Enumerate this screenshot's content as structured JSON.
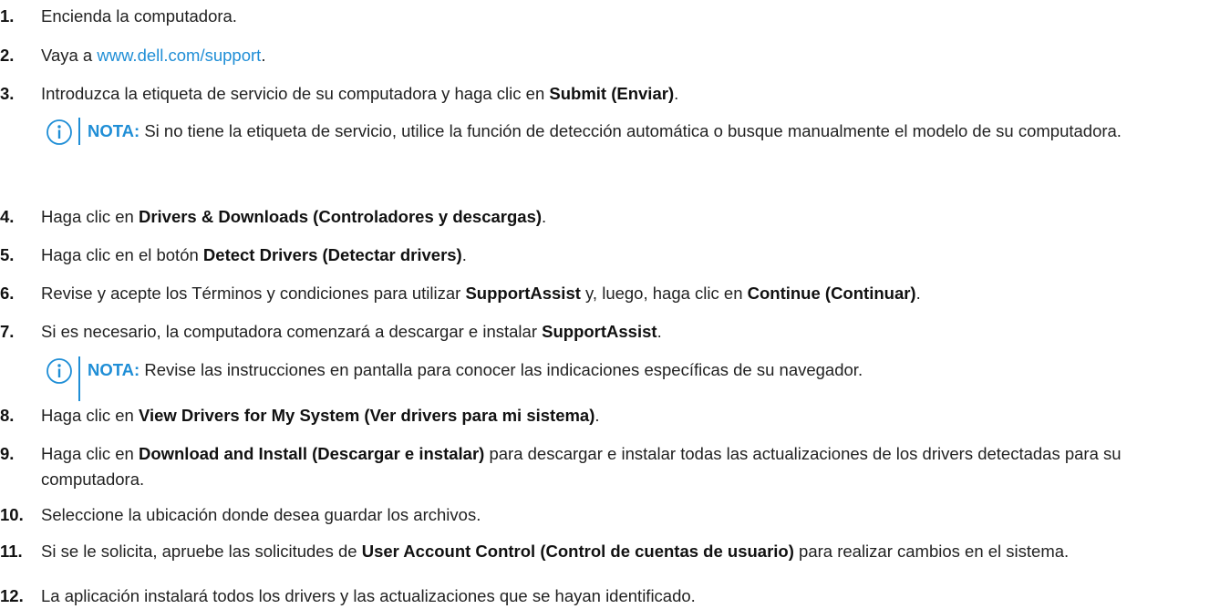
{
  "steps": [
    {
      "num": "1.",
      "text": "Encienda la computadora."
    },
    {
      "num": "2.",
      "prefix": "Vaya a ",
      "link": "www.dell.com/support",
      "suffix": "."
    },
    {
      "num": "3.",
      "prefix": "Introduzca la etiqueta de servicio de su computadora y haga clic en ",
      "bold": "Submit (Enviar)",
      "suffix": "."
    },
    {
      "num": "4.",
      "prefix": "Haga clic en ",
      "bold": "Drivers & Downloads (Controladores y descargas)",
      "suffix": "."
    },
    {
      "num": "5.",
      "prefix": "Haga clic en el botón ",
      "bold": "Detect Drivers (Detectar drivers)",
      "suffix": "."
    },
    {
      "num": "6.",
      "prefix": "Revise y acepte los Términos y condiciones para utilizar ",
      "bold": "SupportAssist",
      "middle": " y, luego, haga clic en ",
      "bold2": "Continue (Continuar)",
      "suffix": "."
    },
    {
      "num": "7.",
      "prefix": "Si es necesario, la computadora comenzará a descargar e instalar ",
      "bold": "SupportAssist",
      "suffix": "."
    },
    {
      "num": "8.",
      "prefix": "Haga clic en ",
      "bold": "View Drivers for My System (Ver drivers para mi sistema)",
      "suffix": "."
    },
    {
      "num": "9.",
      "prefix": "Haga clic en ",
      "bold": "Download and Install (Descargar e instalar)",
      "suffix": " para descargar e instalar todas las actualizaciones de los drivers detectadas para su computadora."
    },
    {
      "num": "10.",
      "text": "Seleccione la ubicación donde desea guardar los archivos."
    },
    {
      "num": "11.",
      "prefix": "Si se le solicita, apruebe las solicitudes de ",
      "bold": "User Account Control (Control de cuentas de usuario)",
      "suffix": " para realizar cambios en el sistema."
    },
    {
      "num": "12.",
      "text": "La aplicación instalará todos los drivers y las actualizaciones que se hayan identificado."
    }
  ],
  "notes": [
    {
      "label": "NOTA:",
      "text": " Si no tiene la etiqueta de servicio, utilice la función de detección automática o busque manualmente el modelo de su computadora."
    },
    {
      "label": "NOTA:",
      "text": " Revise las instrucciones en pantalla para conocer las indicaciones específicas de su navegador."
    }
  ],
  "icons": {
    "note": "info-icon"
  },
  "colors": {
    "accent": "#1f8ed6",
    "text": "#222222"
  }
}
